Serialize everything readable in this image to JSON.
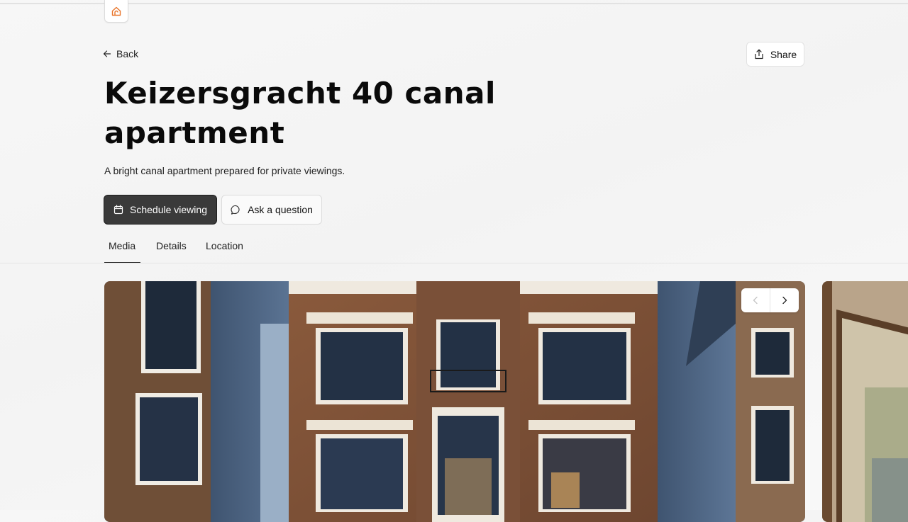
{
  "nav": {
    "back_label": "Back",
    "share_label": "Share"
  },
  "listing": {
    "title": "Keizersgracht 40 canal apartment",
    "subtitle": "A bright canal apartment prepared for private viewings."
  },
  "actions": {
    "schedule_label": "Schedule viewing",
    "ask_label": "Ask a question"
  },
  "tabs": [
    {
      "label": "Media"
    },
    {
      "label": "Details"
    },
    {
      "label": "Location"
    }
  ],
  "active_tab": "Media",
  "media": {
    "images": [
      {
        "description_icon": "canal-house-facade-photo"
      },
      {
        "description_icon": "framed-canal-painting-photo"
      }
    ]
  },
  "colors": {
    "accent_logo": "#e8742a",
    "primary_button": "#3a3a3a"
  }
}
